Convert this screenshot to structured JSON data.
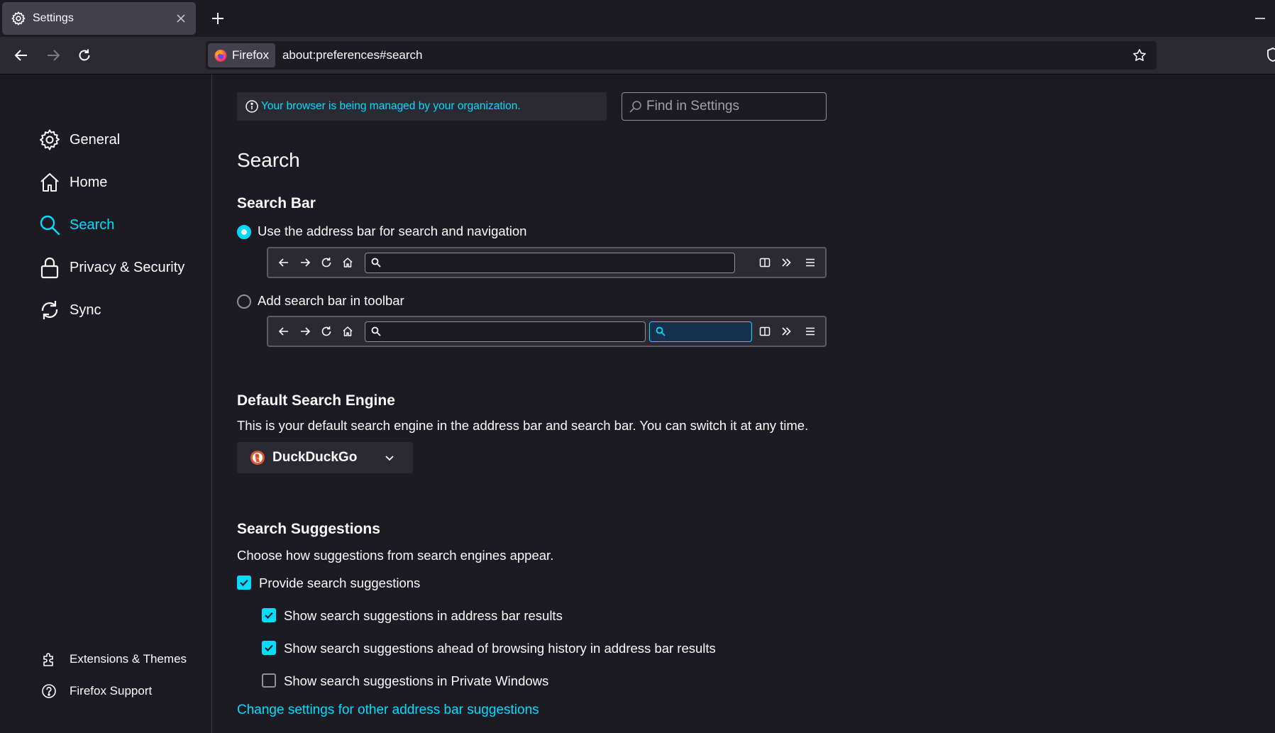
{
  "colors": {
    "background": "#1c1b22",
    "toolbar": "#2b2a33",
    "tab_selected": "#42414d",
    "accent": "#00ddff",
    "text": "#fbfbfe"
  },
  "tab": {
    "title": "Settings",
    "icon": "gear-icon"
  },
  "navbar": {
    "identity_label": "Firefox",
    "url": "about:preferences#search"
  },
  "sidebar": {
    "categories": [
      {
        "label": "General",
        "icon": "gear-icon"
      },
      {
        "label": "Home",
        "icon": "home-icon"
      },
      {
        "label": "Search",
        "icon": "search-icon",
        "selected": true
      },
      {
        "label": "Privacy & Security",
        "icon": "lock-icon"
      },
      {
        "label": "Sync",
        "icon": "sync-icon"
      }
    ],
    "footer": [
      {
        "label": "Extensions & Themes",
        "icon": "puzzle-icon"
      },
      {
        "label": "Firefox Support",
        "icon": "help-icon"
      }
    ]
  },
  "main": {
    "policy_notice": "Your browser is being managed by your organization.",
    "find_placeholder": "Find in Settings",
    "page_title": "Search",
    "search_bar": {
      "heading": "Search Bar",
      "option_address_bar": "Use the address bar for search and navigation",
      "option_toolbar": "Add search bar in toolbar",
      "selected": "address_bar"
    },
    "default_engine": {
      "heading": "Default Search Engine",
      "description": "This is your default search engine in the address bar and search bar. You can switch it at any time.",
      "selected_engine": "DuckDuckGo"
    },
    "suggestions": {
      "heading": "Search Suggestions",
      "description": "Choose how suggestions from search engines appear.",
      "provide": {
        "label": "Provide search suggestions",
        "checked": true
      },
      "address_bar_results": {
        "label": "Show search suggestions in address bar results",
        "checked": true
      },
      "ahead_of_history": {
        "label": "Show search suggestions ahead of browsing history in address bar results",
        "checked": true
      },
      "private_windows": {
        "label": "Show search suggestions in Private Windows",
        "checked": false
      },
      "change_link": "Change settings for other address bar suggestions"
    }
  }
}
